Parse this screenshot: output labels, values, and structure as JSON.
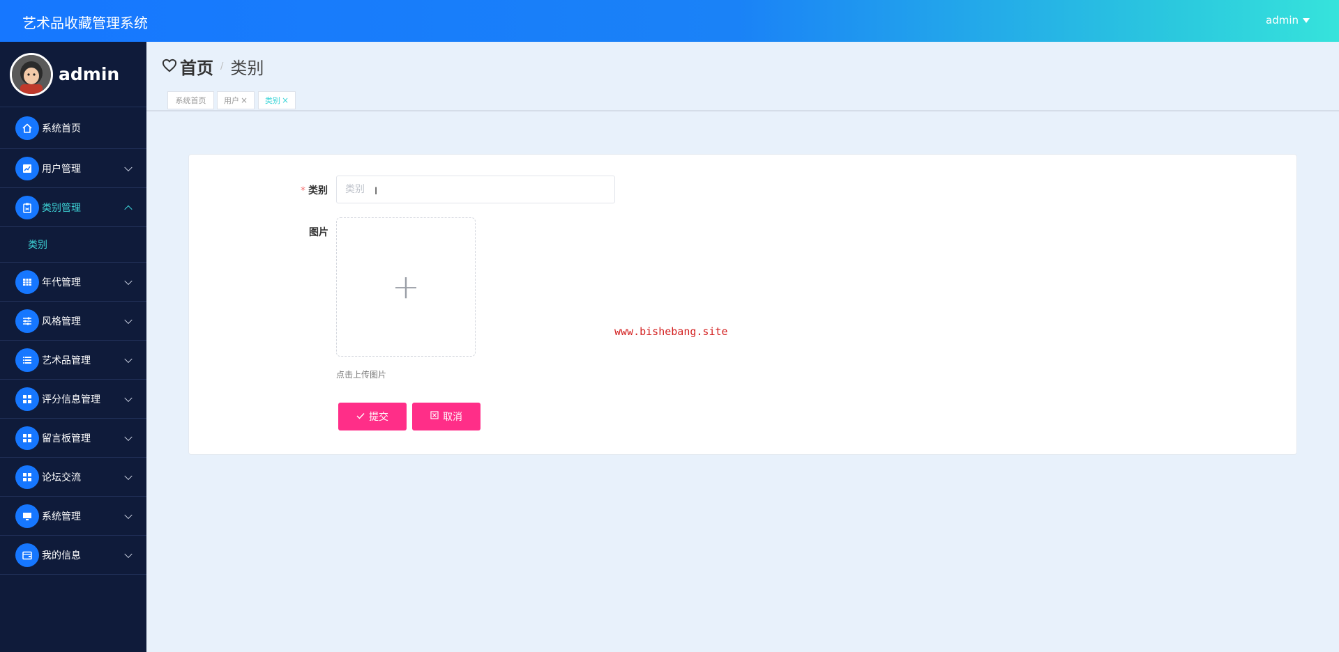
{
  "header": {
    "app_title": "艺术品收藏管理系统",
    "user_label": "admin"
  },
  "sidebar": {
    "username": "admin",
    "items": [
      {
        "label": "系统首页",
        "icon": "home-icon"
      },
      {
        "label": "用户管理",
        "icon": "chart-icon"
      },
      {
        "label": "类别管理",
        "icon": "clipboard-icon",
        "expanded": true,
        "children": [
          "类别"
        ]
      },
      {
        "label": "年代管理",
        "icon": "table-icon"
      },
      {
        "label": "风格管理",
        "icon": "sliders-icon"
      },
      {
        "label": "艺术品管理",
        "icon": "list-icon"
      },
      {
        "label": "评分信息管理",
        "icon": "grid-icon"
      },
      {
        "label": "留言板管理",
        "icon": "grid-icon"
      },
      {
        "label": "论坛交流",
        "icon": "grid-icon"
      },
      {
        "label": "系统管理",
        "icon": "monitor-icon"
      },
      {
        "label": "我的信息",
        "icon": "wallet-icon"
      }
    ]
  },
  "breadcrumb": {
    "home": "首页",
    "separator": "/",
    "current": "类别"
  },
  "tags": [
    {
      "label": "系统首页",
      "closable": false
    },
    {
      "label": "用户",
      "closable": true
    },
    {
      "label": "类别",
      "closable": true,
      "active": true
    }
  ],
  "form": {
    "category_label": "类别",
    "category_required_mark": "*",
    "category_placeholder": "类别",
    "category_value": "",
    "image_label": "图片",
    "upload_hint": "点击上传图片",
    "submit_label": "提交",
    "cancel_label": "取消"
  },
  "watermark": "www.bishebang.site",
  "colors": {
    "accent": "#1677ff",
    "active_text": "#3ed5d8",
    "button": "#ff2e88",
    "sidebar_bg": "#0f1b3a"
  }
}
